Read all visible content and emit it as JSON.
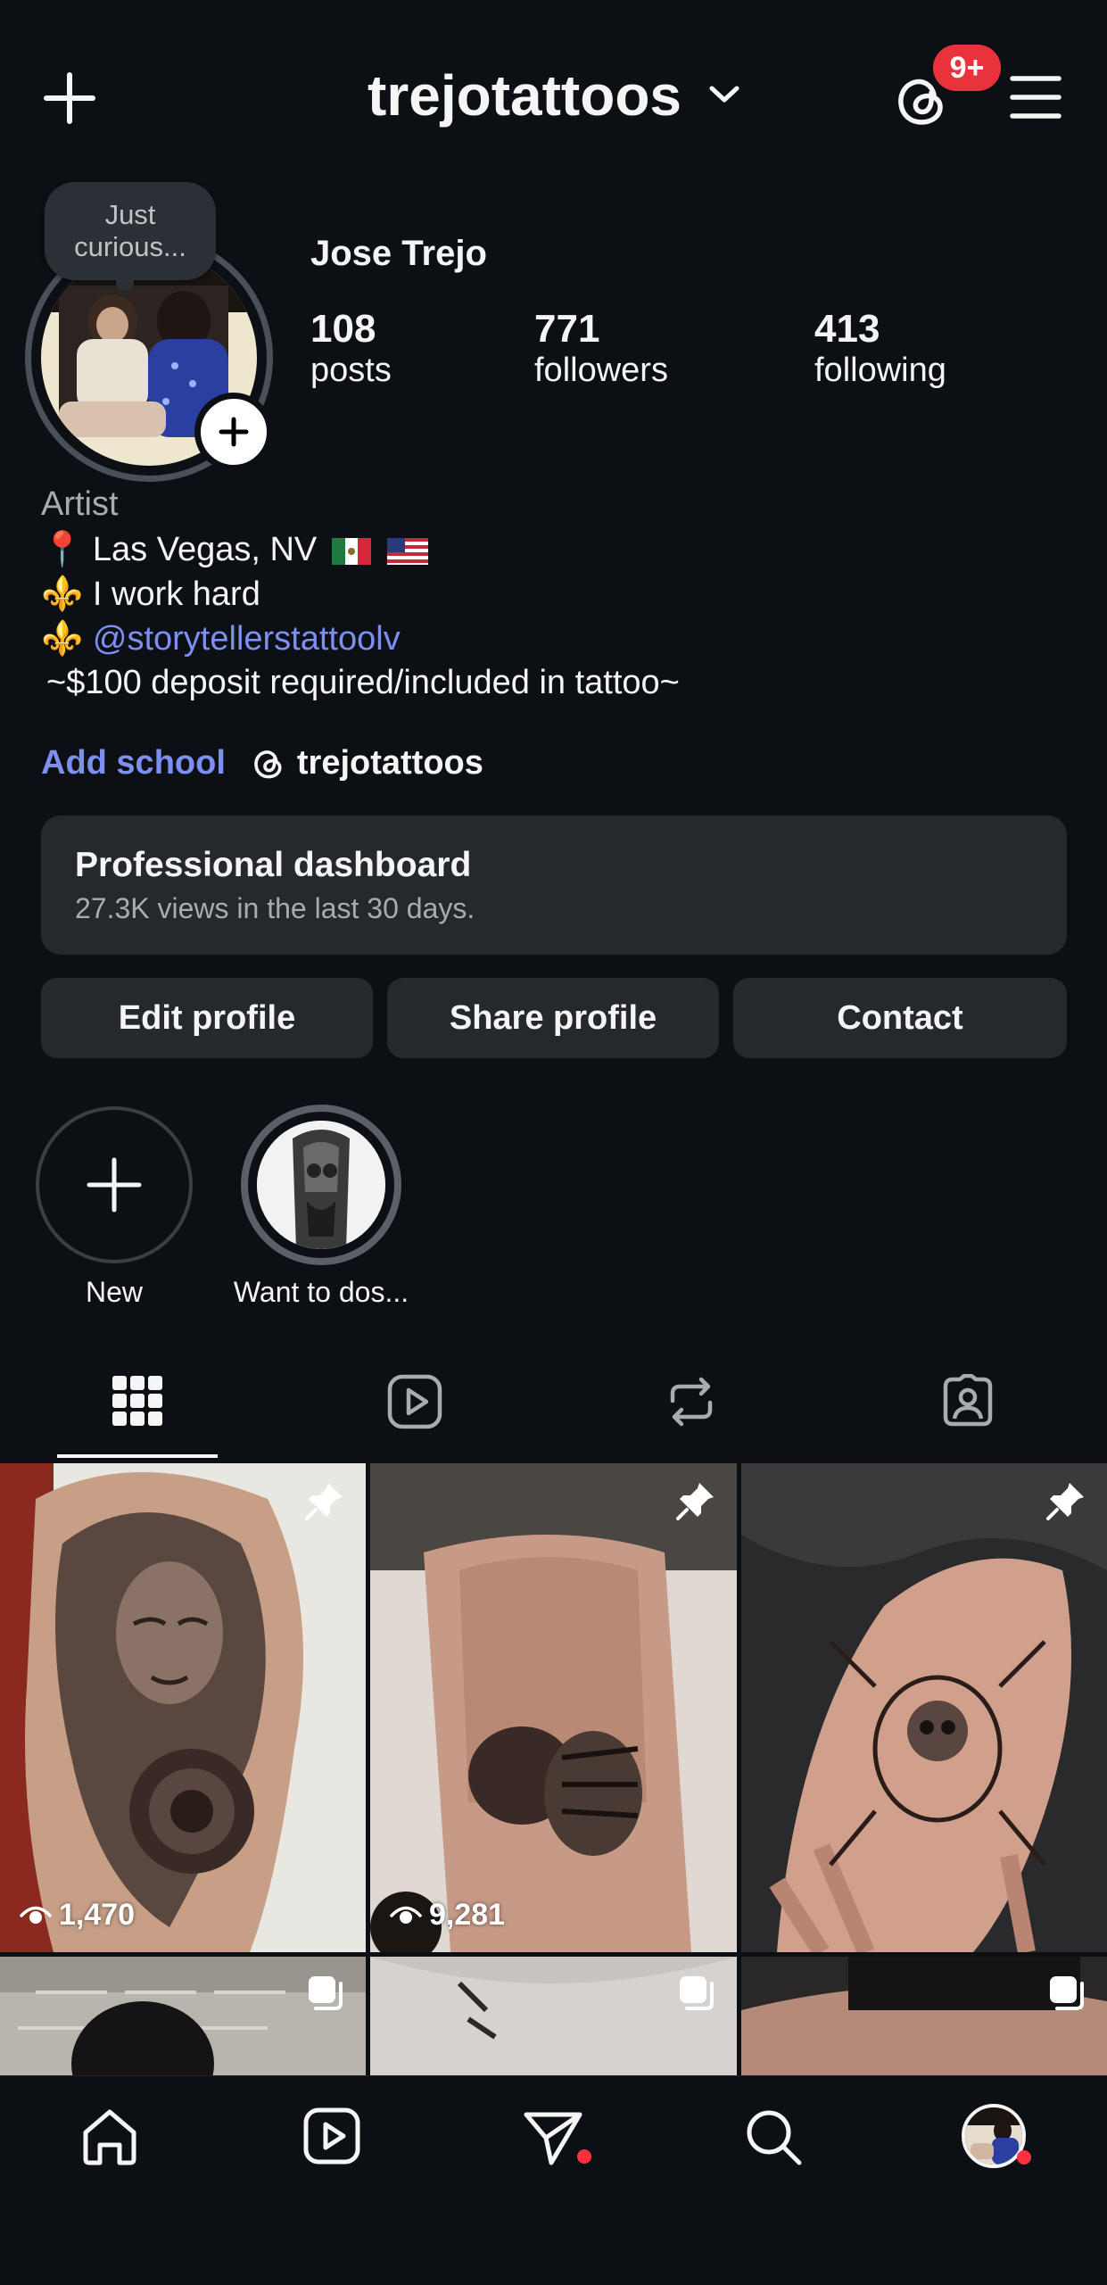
{
  "header": {
    "username": "trejotattoos",
    "notification_badge": "9+"
  },
  "profile": {
    "note": "Just curious...",
    "display_name": "Jose Trejo",
    "stats": [
      {
        "number": "108",
        "label": "posts"
      },
      {
        "number": "771",
        "label": "followers"
      },
      {
        "number": "413",
        "label": "following"
      }
    ]
  },
  "bio": {
    "category": "Artist",
    "line1_emoji": "📍",
    "line1_text": "Las Vegas, NV",
    "line2_emoji": "⚜️",
    "line2_text": "I work hard",
    "line3_emoji": "⚜️",
    "line3_link": "@storytellerstattoolv",
    "line4_text": "~$100 deposit required/included in tattoo~"
  },
  "links": {
    "add_school": "Add school",
    "threads_handle": "trejotattoos"
  },
  "dashboard": {
    "title": "Professional dashboard",
    "subtitle": "27.3K views in the last 30 days."
  },
  "actions": {
    "edit": "Edit profile",
    "share": "Share profile",
    "contact": "Contact"
  },
  "highlights": [
    {
      "label": "New"
    },
    {
      "label": "Want to dos..."
    }
  ],
  "tabs": [
    "grid-icon",
    "reels-icon",
    "reposts-icon",
    "tagged-icon"
  ],
  "grid": [
    {
      "views": "1,470",
      "pinned": true
    },
    {
      "views": "9,281",
      "pinned": true
    },
    {
      "views": "",
      "pinned": true
    },
    {
      "views": "",
      "multi": true
    },
    {
      "views": "",
      "multi": true
    },
    {
      "views": "",
      "multi": true
    }
  ],
  "bottom_nav": [
    "home-icon",
    "reels-icon",
    "messages-icon",
    "search-icon",
    "profile-avatar"
  ],
  "colors": {
    "background": "#0c1014",
    "card": "#25292e",
    "link": "#7d8ff0",
    "badge": "#e8323c"
  }
}
